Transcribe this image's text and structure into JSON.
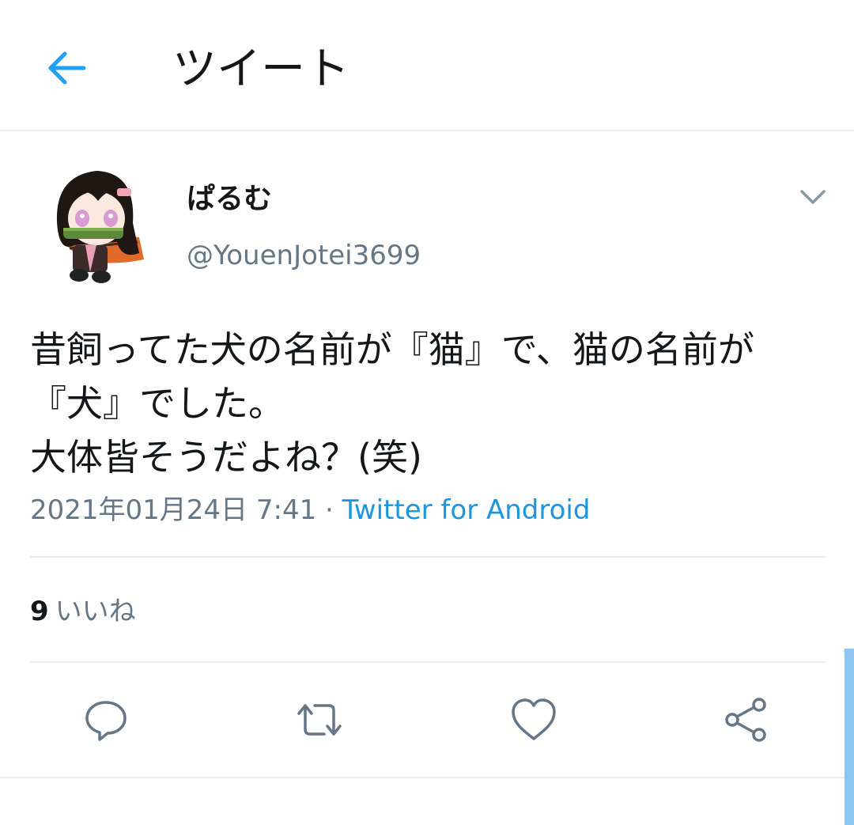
{
  "header": {
    "title": "ツイート"
  },
  "author": {
    "display_name": "ぱるむ",
    "handle": "@YouenJotei3699"
  },
  "tweet": {
    "text_lines": [
      "昔飼ってた犬の名前が『猫』で、猫の名前が",
      "『犬』でした。",
      "大体皆そうだよね？(笑)"
    ],
    "date": "2021年01月24日 7:41",
    "separator": " · ",
    "source": "Twitter for Android"
  },
  "stats": {
    "likes_count": "9",
    "likes_label": "いいね"
  },
  "icons": {
    "back": "back-arrow-icon",
    "caret": "chevron-down-icon",
    "reply": "reply-icon",
    "retweet": "retweet-icon",
    "like": "heart-icon",
    "share": "share-icon"
  },
  "colors": {
    "accent": "#1da1f2",
    "link": "#1b95e0",
    "muted": "#657786",
    "divider": "#e6ecf0"
  }
}
